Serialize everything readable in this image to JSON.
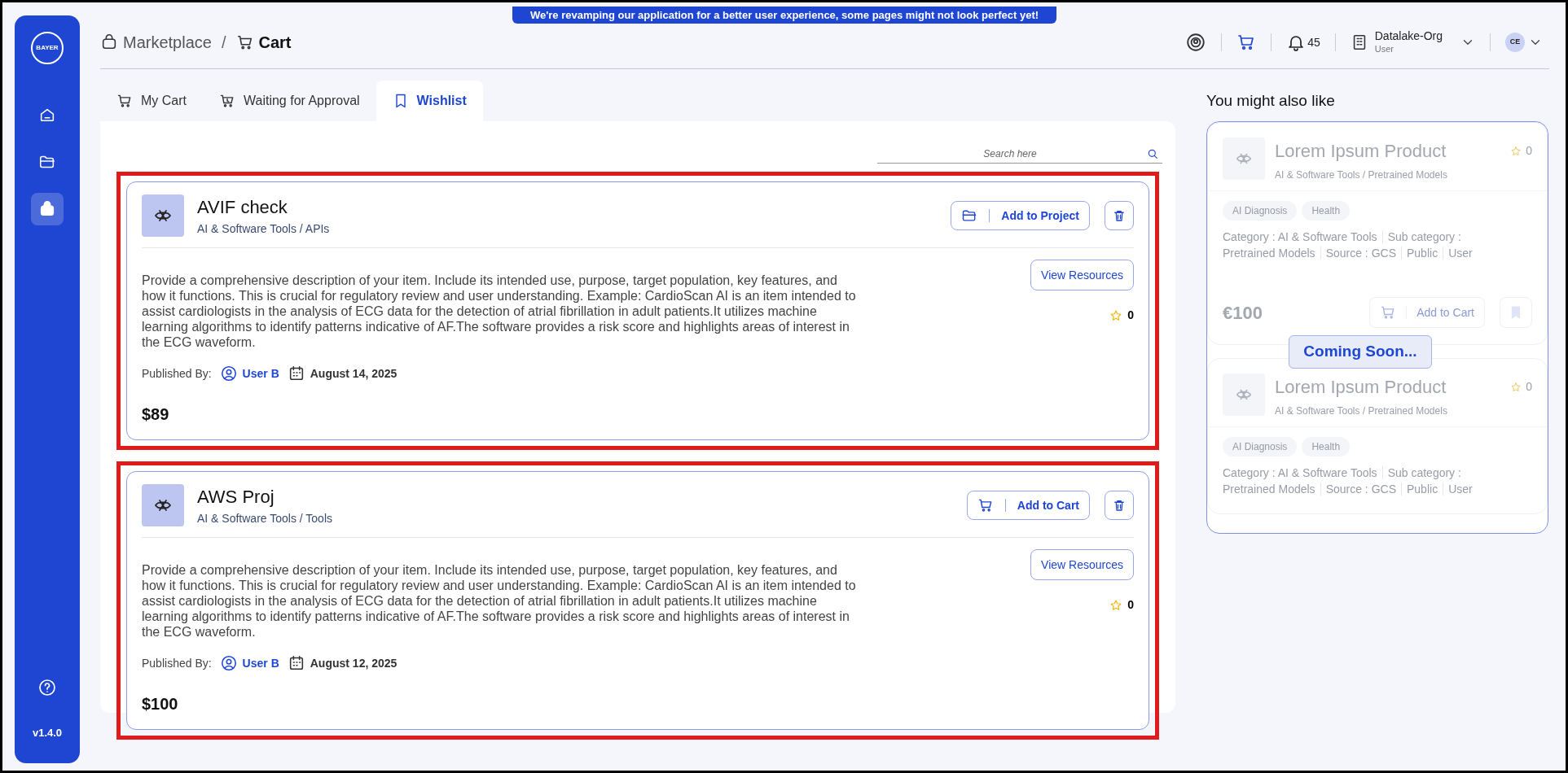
{
  "banner": "We're revamping our application for a better user experience, some pages might not look perfect yet!",
  "sidebar": {
    "logo": "BAYER",
    "items": [
      {
        "kind": "home",
        "selected": false
      },
      {
        "kind": "folder",
        "selected": false
      },
      {
        "kind": "bag",
        "selected": true
      }
    ],
    "version": "v1.4.0"
  },
  "breadcrumb_separator": "/",
  "breadcrumb": [
    {
      "label": "Marketplace",
      "kind": "bag"
    },
    {
      "label": "Cart",
      "kind": "cart"
    }
  ],
  "header": {
    "notifications": "45",
    "org": {
      "name": "Datalake-Org",
      "role": "User"
    },
    "avatar": "CE"
  },
  "tabs": [
    {
      "label": "My Cart",
      "kind": "cart",
      "selected": false
    },
    {
      "label": "Waiting for Approval",
      "kind": "pending",
      "selected": false
    },
    {
      "label": "Wishlist",
      "kind": "bookmark",
      "selected": true
    }
  ],
  "search": {
    "placeholder": "Search here"
  },
  "items": [
    {
      "name": "AVIF check",
      "category": "AI & Software Tools / APIs",
      "action": {
        "kind": "project",
        "label": "Add to Project"
      },
      "resources_label": "View Resources",
      "rating": "0",
      "description": "Provide a comprehensive description of your item. Include its intended use, purpose, target population, key features, and how it functions. This is crucial for regulatory review and user understanding. Example: CardioScan AI is an item intended to assist cardiologists in the analysis of ECG data for the detection of atrial fibrillation in adult patients.It utilizes machine learning algorithms to identify patterns indicative of AF.The software provides a risk score and highlights areas of interest in the ECG waveform.",
      "published_label": "Published By:",
      "user": "User B",
      "date": "August 14, 2025",
      "price": "$89",
      "highlighted": true
    },
    {
      "name": "AWS Proj",
      "category": "AI & Software Tools / Tools",
      "action": {
        "kind": "cart",
        "label": "Add to Cart"
      },
      "resources_label": "View Resources",
      "rating": "0",
      "description": "Provide a comprehensive description of your item. Include its intended use, purpose, target population, key features, and how it functions. This is crucial for regulatory review and user understanding. Example: CardioScan AI is an item intended to assist cardiologists in the analysis of ECG data for the detection of atrial fibrillation in adult patients.It utilizes machine learning algorithms to identify patterns indicative of AF.The software provides a risk score and highlights areas of interest in the ECG waveform.",
      "published_label": "Published By:",
      "user": "User B",
      "date": "August 12, 2025",
      "price": "$100",
      "highlighted": true
    }
  ],
  "recommendations": {
    "title": "You might also like",
    "overlay": "Coming Soon...",
    "items": [
      {
        "name": "Lorem Ipsum Product",
        "rating": "0",
        "category": "AI & Software Tools / Pretrained Models",
        "tags": [
          "AI Diagnosis",
          "Health"
        ],
        "details": [
          "Category : AI & Software Tools",
          "Sub category :",
          "Pretrained Models",
          "Source : GCS",
          "Public",
          "User"
        ],
        "price": "€100",
        "cart_label": "Add to Cart"
      },
      {
        "name": "Lorem Ipsum Product",
        "rating": "0",
        "category": "AI & Software Tools / Pretrained Models",
        "tags": [
          "AI Diagnosis",
          "Health"
        ],
        "details": [
          "Category : AI & Software Tools",
          "Sub category :",
          "Pretrained Models",
          "Source : GCS",
          "Public",
          "User"
        ]
      }
    ]
  }
}
